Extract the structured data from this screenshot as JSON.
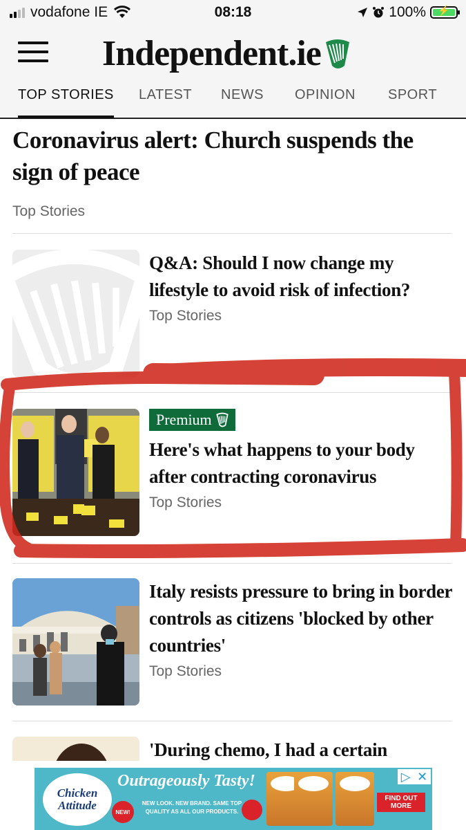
{
  "status_bar": {
    "carrier": "vodafone IE",
    "time": "08:18",
    "battery": "100%",
    "battery_level": 1.0
  },
  "header": {
    "logo": "Independent.ie",
    "tabs": [
      {
        "label": "TOP STORIES",
        "active": true
      },
      {
        "label": "LATEST",
        "active": false
      },
      {
        "label": "NEWS",
        "active": false
      },
      {
        "label": "OPINION",
        "active": false
      },
      {
        "label": "SPORT",
        "active": false
      }
    ]
  },
  "lead_story": {
    "headline": "Coronavirus alert: Church suspends the sign of peace",
    "category": "Top Stories"
  },
  "stories": [
    {
      "headline": "Q&A: Should I now change my lifestyle to avoid risk of infection?",
      "category": "Top Stories",
      "thumbnail": "harp-placeholder"
    },
    {
      "premium_label": "Premium",
      "headline": "Here's what happens to your body after contracting coronavirus",
      "category": "Top Stories",
      "thumbnail": "press-conference-photo"
    },
    {
      "headline": "Italy resists pressure to bring in border controls as citizens 'blocked by other countries'",
      "category": "Top Stories",
      "thumbnail": "venice-bridge-photo"
    },
    {
      "headline": "'During chemo, I had a certain",
      "thumbnail": "portrait-photo"
    }
  ],
  "ad": {
    "brand": "Chicken Attitude",
    "slogan": "Outrageously Tasty!",
    "badge": "NEW!",
    "small_text": "NEW LOOK. NEW BRAND. SAME TOP QUALITY AS ALL OUR PRODUCTS.",
    "cta": "FIND OUT MORE"
  },
  "colors": {
    "premium_green": "#0f6b3a",
    "annotation_red": "#d0281c",
    "harp_green": "#1e8a4a"
  }
}
